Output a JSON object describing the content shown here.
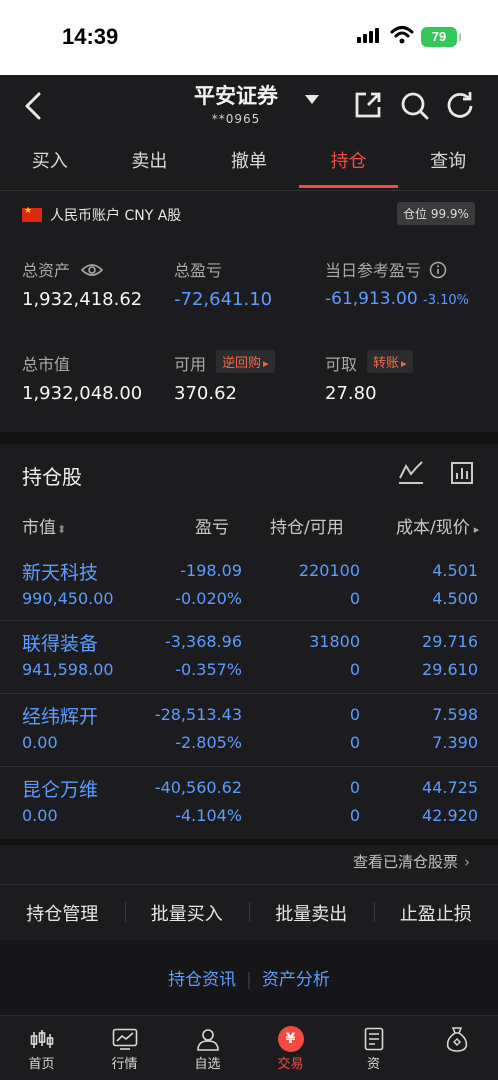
{
  "status_bar": {
    "time": "14:39",
    "battery": "79"
  },
  "header": {
    "title": "平安证券",
    "account": "**0965"
  },
  "tabs": [
    "买入",
    "卖出",
    "撤单",
    "持仓",
    "查询"
  ],
  "active_tab": "持仓",
  "account_line": {
    "label": "人民币账户 CNY A股",
    "position_pct": "仓位 99.9%"
  },
  "summary": {
    "total_assets_label": "总资产",
    "total_assets": "1,932,418.62",
    "total_pnl_label": "总盈亏",
    "total_pnl": "-72,641.10",
    "daily_pnl_label": "当日参考盈亏",
    "daily_pnl": "-61,913.00",
    "daily_pnl_pct": "-3.10%",
    "market_value_label": "总市值",
    "market_value": "1,932,048.00",
    "available_label": "可用",
    "available": "370.62",
    "repo_button": "逆回购",
    "withdrawable_label": "可取",
    "withdrawable": "27.80",
    "transfer_button": "转账"
  },
  "holdings": {
    "title": "持仓股",
    "columns": [
      "市值",
      "盈亏",
      "持仓/可用",
      "成本/现价"
    ],
    "rows": [
      {
        "name": "新天科技",
        "market_value": "990,450.00",
        "pnl": "-198.09",
        "pnl_pct": "-0.020%",
        "position": "220100",
        "available": "0",
        "cost": "4.501",
        "price": "4.500"
      },
      {
        "name": "联得装备",
        "market_value": "941,598.00",
        "pnl": "-3,368.96",
        "pnl_pct": "-0.357%",
        "position": "31800",
        "available": "0",
        "cost": "29.716",
        "price": "29.610"
      },
      {
        "name": "经纬辉开",
        "market_value": "0.00",
        "pnl": "-28,513.43",
        "pnl_pct": "-2.805%",
        "position": "0",
        "available": "0",
        "cost": "7.598",
        "price": "7.390"
      },
      {
        "name": "昆仑万维",
        "market_value": "0.00",
        "pnl": "-40,560.62",
        "pnl_pct": "-4.104%",
        "position": "0",
        "available": "0",
        "cost": "44.725",
        "price": "42.920"
      }
    ],
    "cleared_link": "查看已清仓股票"
  },
  "actions": [
    "持仓管理",
    "批量买入",
    "批量卖出",
    "止盈止损"
  ],
  "links": [
    "持仓资讯",
    "资产分析"
  ],
  "bottom_nav": [
    "首页",
    "行情",
    "自选",
    "交易",
    "资"
  ],
  "colors": {
    "accent": "#f24b3f",
    "loss": "#5b9cff",
    "background": "#1c1c1e"
  }
}
